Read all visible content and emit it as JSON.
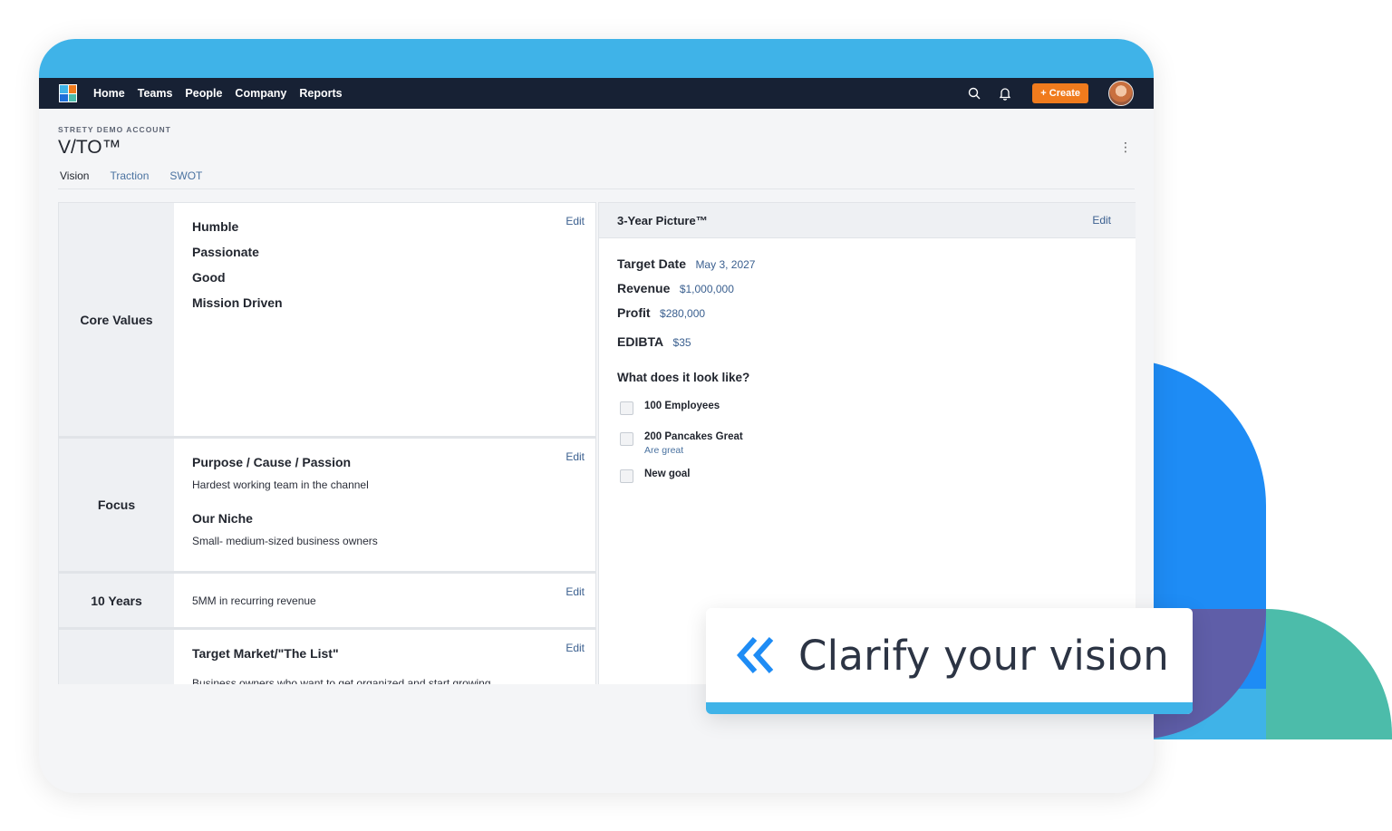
{
  "nav": {
    "items": [
      "Home",
      "Teams",
      "People",
      "Company",
      "Reports"
    ],
    "create_label": "+ Create",
    "icons": [
      "search-icon",
      "bell-icon"
    ]
  },
  "header": {
    "account": "STRETY DEMO ACCOUNT",
    "title": "V/TO™",
    "tabs": [
      "Vision",
      "Traction",
      "SWOT"
    ]
  },
  "core_values": {
    "label": "Core Values",
    "edit": "Edit",
    "items": [
      "Humble",
      "Passionate",
      "Good",
      "Mission Driven"
    ]
  },
  "focus": {
    "label": "Focus",
    "edit": "Edit",
    "purpose_title": "Purpose / Cause / Passion",
    "purpose_text": "Hardest working team in the channel",
    "niche_title": "Our Niche",
    "niche_text": "Small- medium-sized business owners"
  },
  "ten_years": {
    "label": "10 Years",
    "edit": "Edit",
    "text": "5MM in recurring revenue"
  },
  "marketing": {
    "edit": "Edit",
    "title": "Target Market/\"The List\"",
    "text": "Business owners who want to get organized and start growing"
  },
  "three_year": {
    "title": "3-Year Picture™",
    "edit": "Edit",
    "target_date_label": "Target Date",
    "target_date": "May 3, 2027",
    "revenue_label": "Revenue",
    "revenue": "$1,000,000",
    "profit_label": "Profit",
    "profit": "$280,000",
    "edibta_label": "EDIBTA",
    "edibta": "$35",
    "look_title": "What does it look like?",
    "goals": [
      {
        "label": "100 Employees",
        "note": ""
      },
      {
        "label": "200 Pancakes Great",
        "note": "Are great"
      },
      {
        "label": "New goal",
        "note": ""
      }
    ]
  },
  "callout": {
    "text": "Clarify your vision"
  },
  "colors": {
    "brand_blue": "#3fb3e8",
    "nav_bg": "#172134",
    "create_orange": "#f07b1d",
    "link_blue": "#3a5f8f"
  }
}
